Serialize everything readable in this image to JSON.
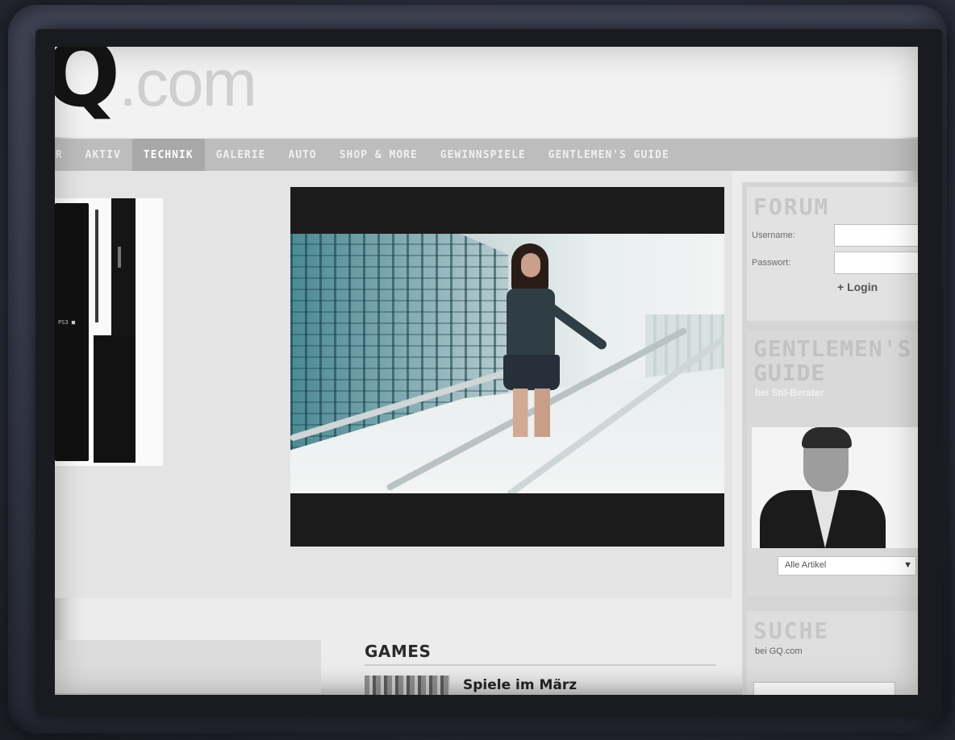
{
  "logo": {
    "main": "Q",
    "suffix": ".com"
  },
  "nav": {
    "items": [
      {
        "label": "UR"
      },
      {
        "label": "AKTIV"
      },
      {
        "label": "TECHNIK"
      },
      {
        "label": "GALERIE"
      },
      {
        "label": "AUTO"
      },
      {
        "label": "SHOP & MORE"
      },
      {
        "label": "GEWINNSPIELE"
      },
      {
        "label": "GENTLEMEN'S GUIDE"
      }
    ],
    "active": "TECHNIK"
  },
  "product": {
    "logo_text": "PS3 ■"
  },
  "forum": {
    "title": "FORUM",
    "username_label": "Username:",
    "password_label": "Passwort:",
    "login_label": "+ Login"
  },
  "guide": {
    "title": "GENTLEMEN'S\nGUIDE",
    "subtitle": "bei Stil-Berater",
    "select_value": "Alle Artikel"
  },
  "search": {
    "title": "SUCHE",
    "subtitle": "bei GQ.com"
  },
  "games": {
    "title": "GAMES",
    "items": [
      {
        "label": "Spiele im März"
      }
    ]
  },
  "colors": {
    "nav_bg": "#bdbdbd",
    "nav_active": "#a8a8a8",
    "page_bg": "#ececec",
    "bezel": "#3f4456"
  },
  "icons": {
    "select_arrow": "chevron-down-icon"
  }
}
